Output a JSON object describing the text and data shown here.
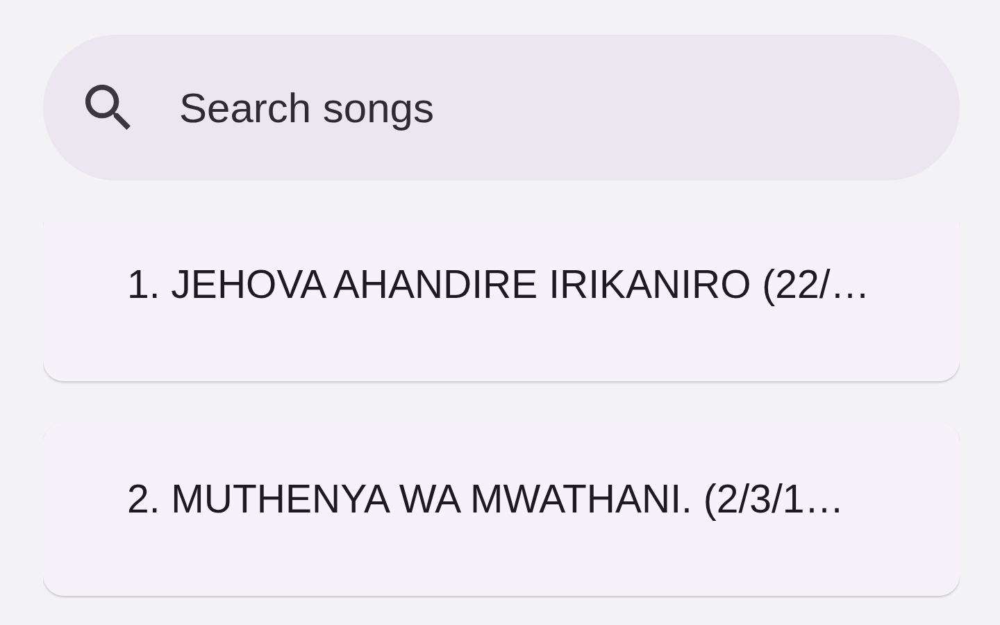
{
  "search": {
    "placeholder": "Search songs"
  },
  "songs": [
    "1. JEHOVA AHANDIRE IRIKANIRO (22/…",
    "2. MUTHENYA WA MWATHANI. (2/3/1…"
  ]
}
